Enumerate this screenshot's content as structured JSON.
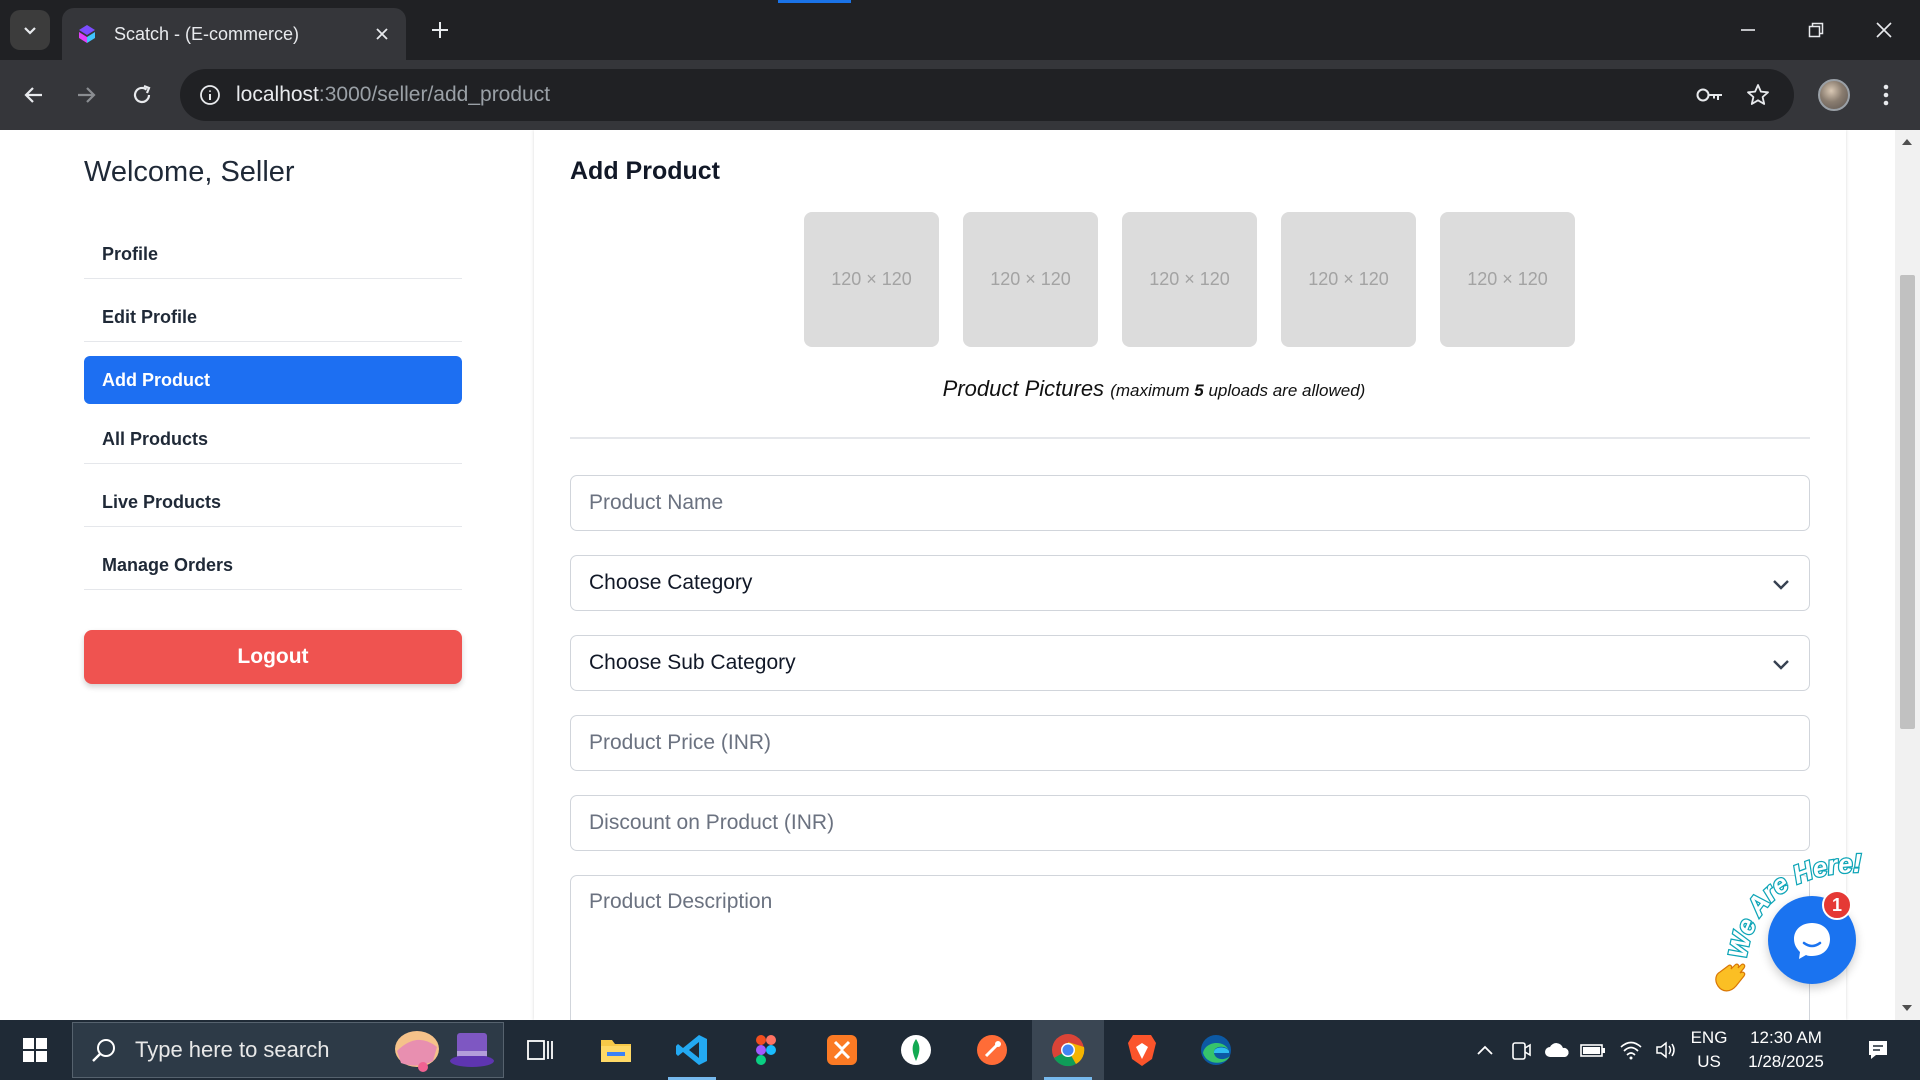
{
  "browser": {
    "tab_title": "Scatch - (E-commerce)",
    "url_host": "localhost",
    "url_rest": ":3000/seller/add_product"
  },
  "sidebar": {
    "welcome": "Welcome, Seller",
    "items": [
      {
        "label": "Profile",
        "active": false
      },
      {
        "label": "Edit Profile",
        "active": false
      },
      {
        "label": "Add Product",
        "active": true
      },
      {
        "label": "All Products",
        "active": false
      },
      {
        "label": "Live Products",
        "active": false
      },
      {
        "label": "Manage Orders",
        "active": false
      }
    ],
    "logout_label": "Logout"
  },
  "main": {
    "heading": "Add Product",
    "thumbnails": [
      "120 × 120",
      "120 × 120",
      "120 × 120",
      "120 × 120",
      "120 × 120"
    ],
    "pictures_caption": "Product Pictures",
    "pictures_note_prefix": "(maximum ",
    "pictures_note_count": "5",
    "pictures_note_suffix": " uploads are allowed)",
    "product_name_placeholder": "Product Name",
    "category_value": "Choose Category",
    "sub_category_value": "Choose Sub Category",
    "price_placeholder": "Product Price (INR)",
    "discount_placeholder": "Discount on Product (INR)",
    "description_placeholder": "Product Description"
  },
  "chat_widget": {
    "text": "We Are Here!",
    "badge_count": "1"
  },
  "taskbar": {
    "search_placeholder": "Type here to search",
    "lang_line1": "ENG",
    "lang_line2": "US",
    "time": "12:30 AM",
    "date": "1/28/2025"
  },
  "colors": {
    "primary": "#1d6ff2",
    "danger": "#ef5350",
    "chrome_dark": "#202124",
    "chrome_toolbar": "#35363a"
  }
}
